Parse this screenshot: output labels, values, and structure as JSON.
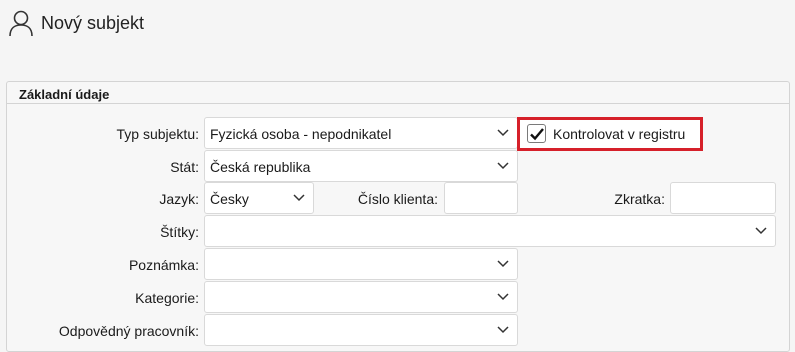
{
  "header": {
    "title": "Nový subjekt",
    "icon": "user-icon"
  },
  "section": {
    "title": "Základní údaje"
  },
  "form": {
    "typ_subjektu": {
      "label": "Typ subjektu:",
      "value": "Fyzická osoba - nepodnikatel"
    },
    "kontrolovat": {
      "label": "Kontrolovat v registru",
      "checked": true
    },
    "stat": {
      "label": "Stát:",
      "value": "Česká republika"
    },
    "jazyk": {
      "label": "Jazyk:",
      "value": "Česky"
    },
    "cislo_klienta": {
      "label": "Číslo klienta:",
      "value": ""
    },
    "zkratka": {
      "label": "Zkratka:",
      "value": ""
    },
    "stitky": {
      "label": "Štítky:",
      "value": ""
    },
    "poznamka": {
      "label": "Poznámka:",
      "value": ""
    },
    "kategorie": {
      "label": "Kategorie:",
      "value": ""
    },
    "odpovedny": {
      "label": "Odpovědný pracovník:",
      "value": ""
    }
  },
  "colors": {
    "highlight": "#d6202a",
    "panel_bg": "#f7f7f7",
    "field_bg": "#ffffff"
  }
}
